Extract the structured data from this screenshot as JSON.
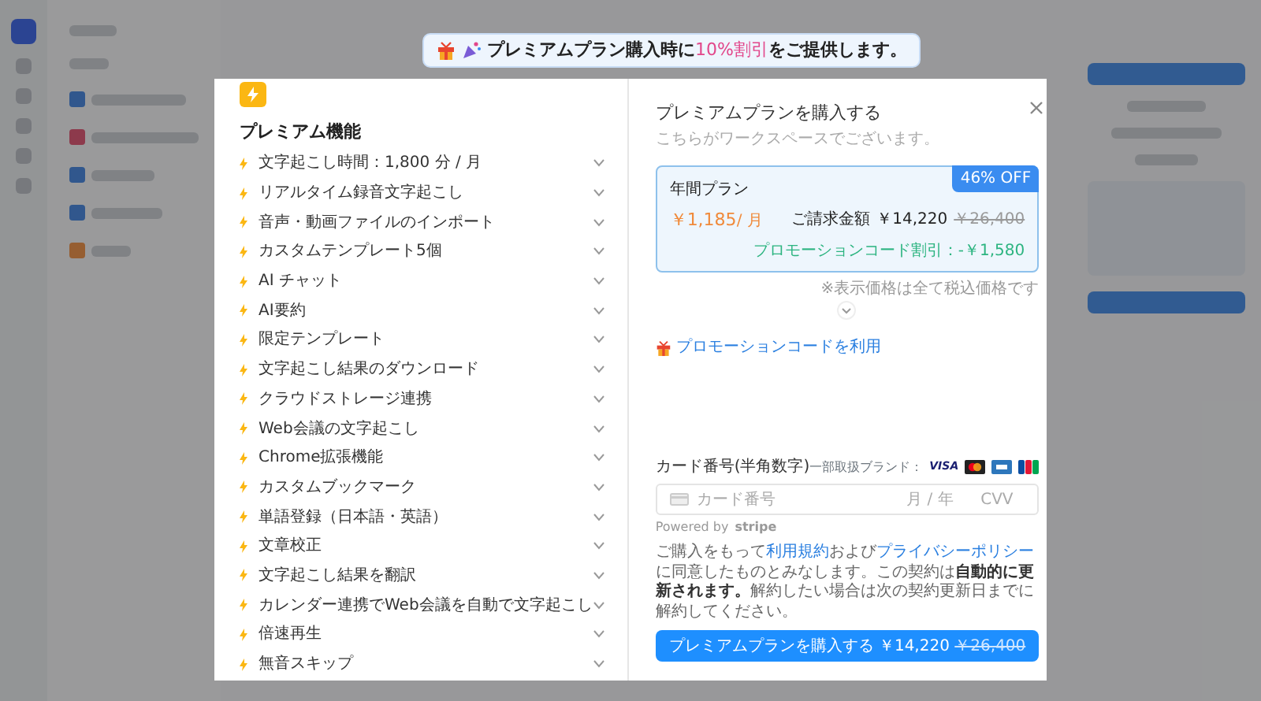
{
  "banner": {
    "lead": "プレミアムプラン購入時に",
    "highlight": "10%割引",
    "trail": "をご提供します。"
  },
  "features": {
    "title": "プレミアム機能",
    "items": [
      {
        "label": "文字起こし時間：1,800 分 / 月",
        "expanded": false
      },
      {
        "label": "リアルタイム録音文字起こし",
        "expanded": false
      },
      {
        "label": "音声・動画ファイルのインポート",
        "expanded": false
      },
      {
        "label": "カスタムテンプレート5個",
        "expanded": false
      },
      {
        "label": "AI チャット",
        "expanded": false
      },
      {
        "label": "AI要約",
        "expanded": false
      },
      {
        "label": "限定テンプレート",
        "expanded": false
      },
      {
        "label": "文字起こし結果のダウンロード",
        "expanded": false
      },
      {
        "label": "クラウドストレージ連携",
        "expanded": false
      },
      {
        "label": "Web会議の文字起こし",
        "expanded": false
      },
      {
        "label": "Chrome拡張機能",
        "expanded": false
      },
      {
        "label": "カスタムブックマーク",
        "expanded": false
      },
      {
        "label": "単語登録（日本語・英語）",
        "expanded": false
      },
      {
        "label": "文章校正",
        "expanded": false
      },
      {
        "label": "文字起こし結果を翻訳",
        "expanded": false
      },
      {
        "label": "カレンダー連携でWeb会議を自動で文字起こし",
        "expanded": false
      },
      {
        "label": "倍速再生",
        "expanded": false
      },
      {
        "label": "無音スキップ",
        "expanded": false
      }
    ]
  },
  "purchase": {
    "title": "プレミアムプランを購入する",
    "subtitle": "こちらがワークスペースでございます。",
    "plan": {
      "name": "年間プラン",
      "price": "￥1,185",
      "unit": "/ 月",
      "badge": "46% OFF",
      "billing_label": "ご請求金額",
      "billing_amount": "￥14,220",
      "original_amount": "￥26,400",
      "promo_discount": "プロモーションコード割引：-￥1,580",
      "selected": true
    },
    "tax_note": "※表示価格は全て税込価格です",
    "promo_link": "プロモーションコードを利用",
    "card": {
      "label": "カード番号(半角数字)",
      "brands_label": "一部取扱ブランド：",
      "visa": "VISA",
      "number_placeholder": "カード番号",
      "expiry_placeholder": "月 / 年",
      "cvc_placeholder": "CVV",
      "powered_by": "Powered by",
      "provider": "stripe"
    },
    "terms": [
      {
        "kind": "plain",
        "text": "ご購入をもって"
      },
      {
        "kind": "link",
        "text": "利用規約"
      },
      {
        "kind": "plain",
        "text": "および"
      },
      {
        "kind": "link",
        "text": "プライバシーポリシー"
      },
      {
        "kind": "plain",
        "text": "に同意したものとみなします。この契約は"
      },
      {
        "kind": "bold",
        "text": "自動的に更新されます。"
      },
      {
        "kind": "plain",
        "text": "解約したい場合は次の契約更新日までに解約してください。"
      }
    ],
    "buy_button": {
      "label": "プレミアムプランを購入する",
      "amount": "￥14,220",
      "original_amount": "￥26,400"
    }
  }
}
